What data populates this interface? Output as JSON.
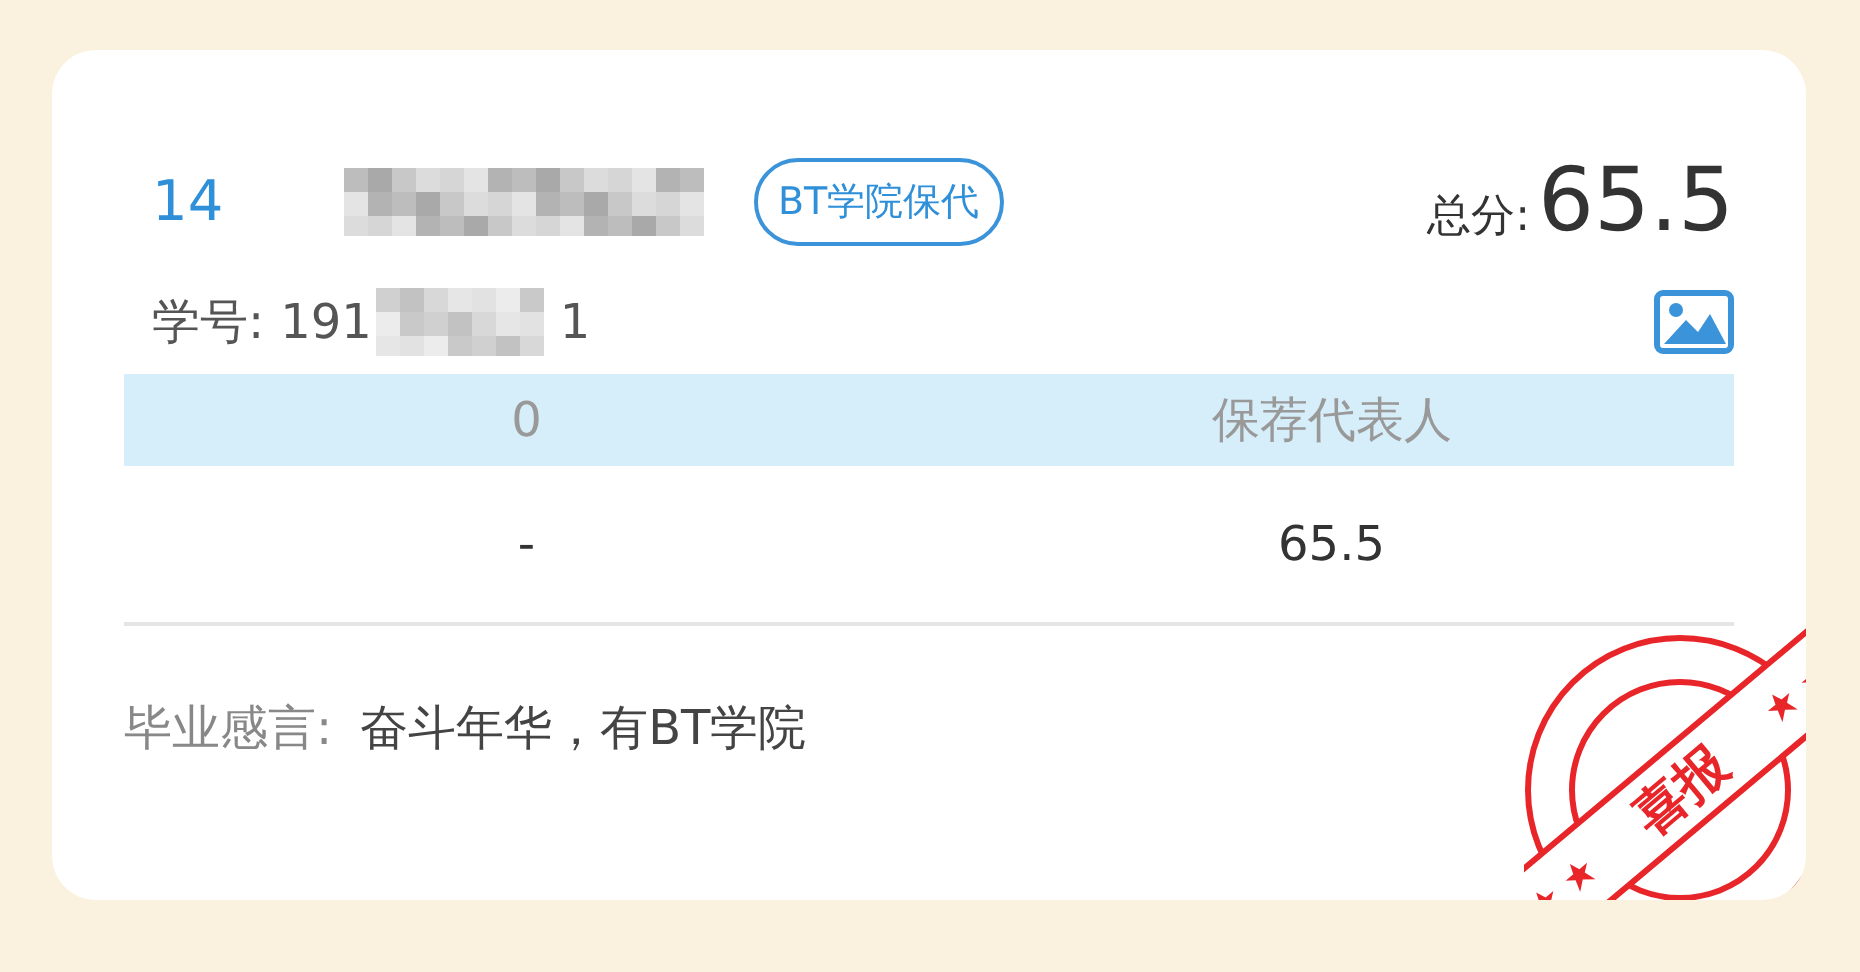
{
  "card": {
    "rank": "14",
    "badge": "BT学院保代",
    "total_label": "总分:",
    "total": "65.5",
    "student_id": {
      "label": "学号:",
      "start": "191",
      "end": "1"
    },
    "table": {
      "columns": [
        "0",
        "保荐代表人"
      ],
      "rows": [
        [
          "-",
          "65.5"
        ]
      ]
    },
    "motto": {
      "label": "毕业感言:",
      "text": "奋斗年华，有BT学院"
    },
    "stamp": {
      "text": "喜报"
    }
  }
}
